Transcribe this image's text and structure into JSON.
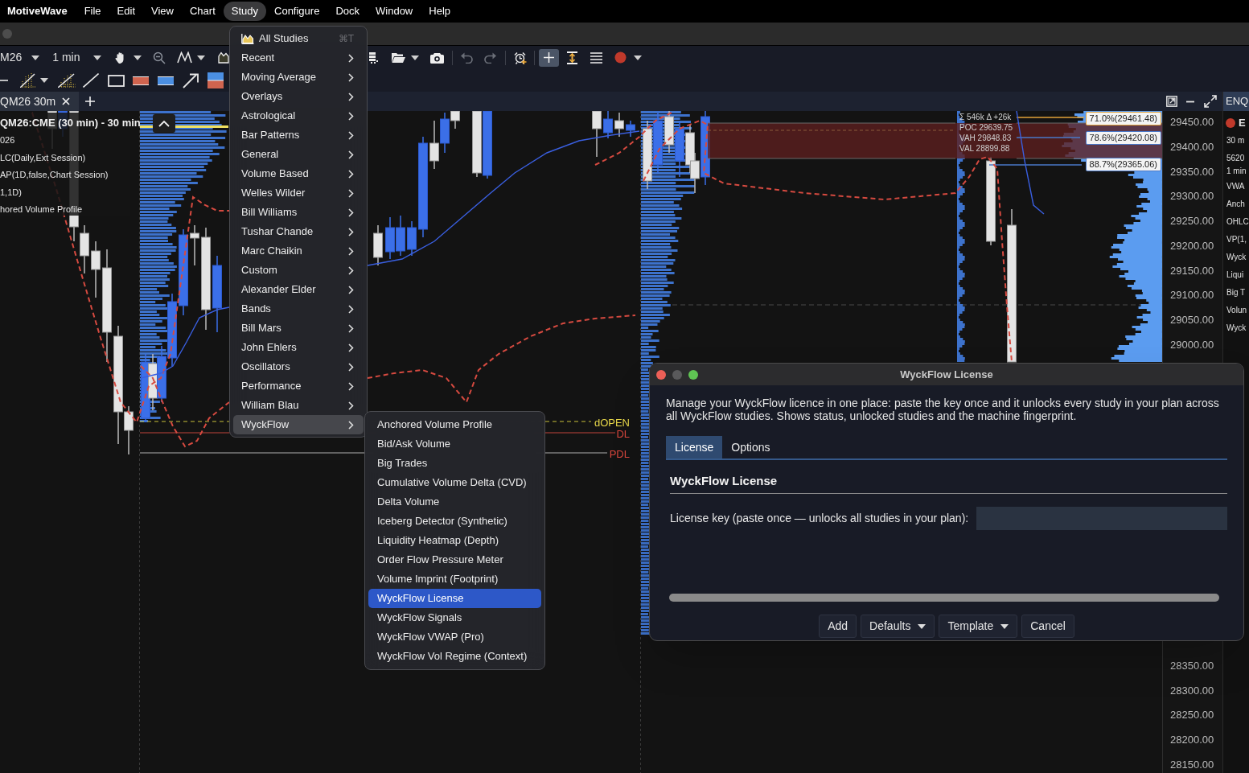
{
  "menu_bar": {
    "app_name": "MotiveWave",
    "items": [
      {
        "label": "File",
        "selected": false
      },
      {
        "label": "Edit",
        "selected": false
      },
      {
        "label": "View",
        "selected": false
      },
      {
        "label": "Chart",
        "selected": false
      },
      {
        "label": "Study",
        "selected": true
      },
      {
        "label": "Configure",
        "selected": false
      },
      {
        "label": "Dock",
        "selected": false
      },
      {
        "label": "Window",
        "selected": false
      },
      {
        "label": "Help",
        "selected": false
      }
    ]
  },
  "toolbar": {
    "symbol": "M26",
    "interval": "1 min",
    "toggle_tools": [
      {
        "selected": true
      },
      {
        "selected": false
      },
      {
        "selected": false
      }
    ]
  },
  "chart_tab": {
    "label": "QM26 30m"
  },
  "chart": {
    "title": "QM26:CME (30 min) - 30 min",
    "legend": [
      "026",
      "LC(Daily,Ext Session)",
      "AP(1D,false,Chart Session)",
      "1,1D)",
      "hored Volume Profile"
    ],
    "profile_stats": [
      "Σ 546k Δ +26k",
      "POC 29639.75",
      "VAH 29848.83",
      "VAL 28899.88"
    ],
    "level_tags": [
      {
        "label": "71.0%(29461.48)",
        "color": "#e3a33a"
      },
      {
        "label": "78.6%(29420.08)",
        "color": "#4a78c8"
      },
      {
        "label": "88.7%(29365.06)",
        "color": "#4a78c8"
      }
    ],
    "line_labels": [
      {
        "label": "dOPEN",
        "color": "#e8d84a"
      },
      {
        "label": "DL",
        "color": "#d9473d"
      },
      {
        "label": "PDL",
        "color": "#d9473d"
      }
    ]
  },
  "price_axis": {
    "upper": [
      "29450.00",
      "29400.00",
      "29350.00",
      "29300.00",
      "29250.00",
      "29200.00",
      "29150.00",
      "29100.00",
      "29050.00",
      "29000.00"
    ],
    "lower": [
      "28350.00",
      "28300.00",
      "28250.00",
      "28200.00",
      "28150.00"
    ]
  },
  "side_panel": {
    "tab": "ENQ",
    "header": "E",
    "timeframe": "30 m",
    "info_lines": [
      "5620",
      "1 min"
    ],
    "studies": [
      "VWA",
      "Anch",
      "OHLC",
      "VP(1,",
      "Wyck",
      "Liqui",
      "Big T",
      "Volun",
      "Wyck"
    ]
  },
  "study_menu": [
    {
      "label": "All Studies",
      "kind": "command",
      "shortcut": "⌘T",
      "selected": false
    },
    {
      "label": "Recent",
      "kind": "submenu",
      "selected": false
    },
    {
      "label": "Moving Average",
      "kind": "submenu",
      "selected": false
    },
    {
      "label": "Overlays",
      "kind": "submenu",
      "selected": false
    },
    {
      "label": "Astrological",
      "kind": "submenu",
      "selected": false
    },
    {
      "label": "Bar Patterns",
      "kind": "submenu",
      "selected": false
    },
    {
      "label": "General",
      "kind": "submenu",
      "selected": false
    },
    {
      "label": "Volume Based",
      "kind": "submenu",
      "selected": false
    },
    {
      "label": "Welles Wilder",
      "kind": "submenu",
      "selected": false
    },
    {
      "label": "Bill Williams",
      "kind": "submenu",
      "selected": false
    },
    {
      "label": "Tushar Chande",
      "kind": "submenu",
      "selected": false
    },
    {
      "label": "Marc Chaikin",
      "kind": "submenu",
      "selected": false
    },
    {
      "label": "Custom",
      "kind": "submenu",
      "selected": false
    },
    {
      "label": "Alexander Elder",
      "kind": "submenu",
      "selected": false
    },
    {
      "label": "Bands",
      "kind": "submenu",
      "selected": false
    },
    {
      "label": "Bill Mars",
      "kind": "submenu",
      "selected": false
    },
    {
      "label": "John Ehlers",
      "kind": "submenu",
      "selected": false
    },
    {
      "label": "Oscillators",
      "kind": "submenu",
      "selected": false
    },
    {
      "label": "Performance",
      "kind": "submenu",
      "selected": false
    },
    {
      "label": "William Blau",
      "kind": "submenu",
      "selected": false
    },
    {
      "label": "WyckFlow",
      "kind": "submenu",
      "selected": true
    }
  ],
  "wyckflow_submenu": [
    {
      "label": "Anchored Volume Profile",
      "selected": false
    },
    {
      "label": "Bid/Ask Volume",
      "selected": false
    },
    {
      "label": "Big Trades",
      "selected": false
    },
    {
      "label": "Cumulative Volume Delta (CVD)",
      "selected": false
    },
    {
      "label": "Delta Volume",
      "selected": false
    },
    {
      "label": "Iceberg Detector (Synthetic)",
      "selected": false
    },
    {
      "label": "Liquidity Heatmap (Depth)",
      "selected": false
    },
    {
      "label": "Order Flow Pressure Meter",
      "selected": false
    },
    {
      "label": "Volume Imprint (Footprint)",
      "selected": false
    },
    {
      "label": "WyckFlow License",
      "selected": true
    },
    {
      "label": "WyckFlow Signals",
      "selected": false
    },
    {
      "label": "WyckFlow VWAP (Pro)",
      "selected": false
    },
    {
      "label": "WyckFlow Vol Regime (Context)",
      "selected": false
    }
  ],
  "dialog": {
    "title": "WyckFlow License",
    "description": "Manage your WyckFlow licence in one place: paste the key once and it unlocks every study in your plan across all WyckFlow studies. Shows status, unlocked studies and the machine fingerprint.",
    "tabs": [
      {
        "label": "License",
        "selected": true
      },
      {
        "label": "Options",
        "selected": false
      }
    ],
    "section_title": "WyckFlow License",
    "field_label": "License key (paste once — unlocks all studies in your plan):",
    "buttons": [
      {
        "label": "Add",
        "kind": "plain"
      },
      {
        "label": "Defaults",
        "kind": "dropdown"
      },
      {
        "label": "Template",
        "kind": "dropdown"
      },
      {
        "label": "Cancel",
        "kind": "plain"
      }
    ]
  }
}
